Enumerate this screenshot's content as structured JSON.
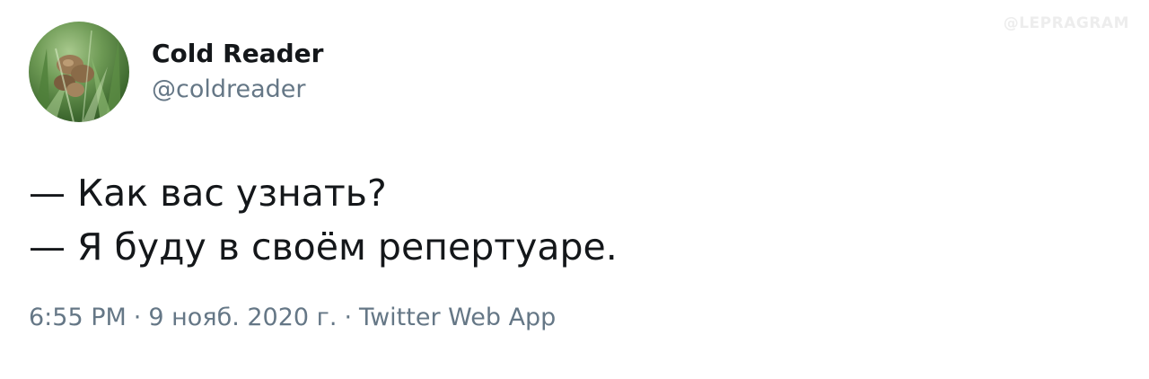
{
  "watermark": "@LEPRAGRAM",
  "author": {
    "display_name": "Cold Reader",
    "handle": "@coldreader",
    "avatar_icon": "avatar-photo"
  },
  "tweet": {
    "lines": [
      "— Как вас узнать?",
      "— Я буду в своём репертуаре."
    ],
    "time": "6:55 PM",
    "date": "9 нояб. 2020 г.",
    "source": "Twitter Web App",
    "separator": "·"
  },
  "colors": {
    "text_primary": "#14171a",
    "text_secondary": "#657786",
    "watermark": "#ededed"
  }
}
